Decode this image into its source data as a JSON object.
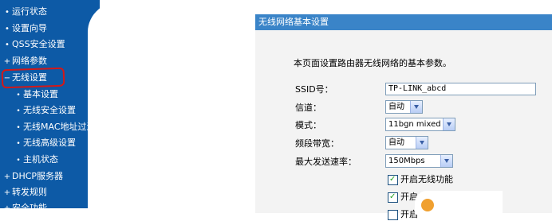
{
  "sidebar": {
    "items": [
      {
        "label": "运行状态",
        "mark": "•"
      },
      {
        "label": "设置向导",
        "mark": "•"
      },
      {
        "label": "QSS安全设置",
        "mark": "•"
      },
      {
        "label": "网络参数",
        "mark": "+"
      },
      {
        "label": "无线设置",
        "mark": "−"
      },
      {
        "label": "基本设置",
        "mark": "•"
      },
      {
        "label": "无线安全设置",
        "mark": "•"
      },
      {
        "label": "无线MAC地址过滤",
        "mark": "•"
      },
      {
        "label": "无线高级设置",
        "mark": "•"
      },
      {
        "label": "主机状态",
        "mark": "•"
      },
      {
        "label": "DHCP服务器",
        "mark": "+"
      },
      {
        "label": "转发规则",
        "mark": "+"
      },
      {
        "label": "安全功能",
        "mark": "+"
      }
    ]
  },
  "panel": {
    "title": "无线网络基本设置",
    "description": "本页面设置路由器无线网络的基本参数。",
    "ssid": {
      "label": "SSID号：",
      "value": "TP-LINK_abcd"
    },
    "channel": {
      "label": "信道：",
      "value": "自动"
    },
    "mode": {
      "label": "模式：",
      "value": "11bgn mixed"
    },
    "bandwidth": {
      "label": "频段带宽：",
      "value": "自动"
    },
    "max_rate": {
      "label": "最大发送速率：",
      "value": "150Mbps"
    },
    "checkboxes": [
      {
        "label": "开启无线功能",
        "checked": true
      },
      {
        "label": "开启SSID广播",
        "checked": true
      },
      {
        "label": "开启",
        "checked": false
      }
    ]
  },
  "colors": {
    "sidebar_bg": "#0d5aa6",
    "header_bg": "#3a84c8",
    "highlight": "#d31818"
  }
}
